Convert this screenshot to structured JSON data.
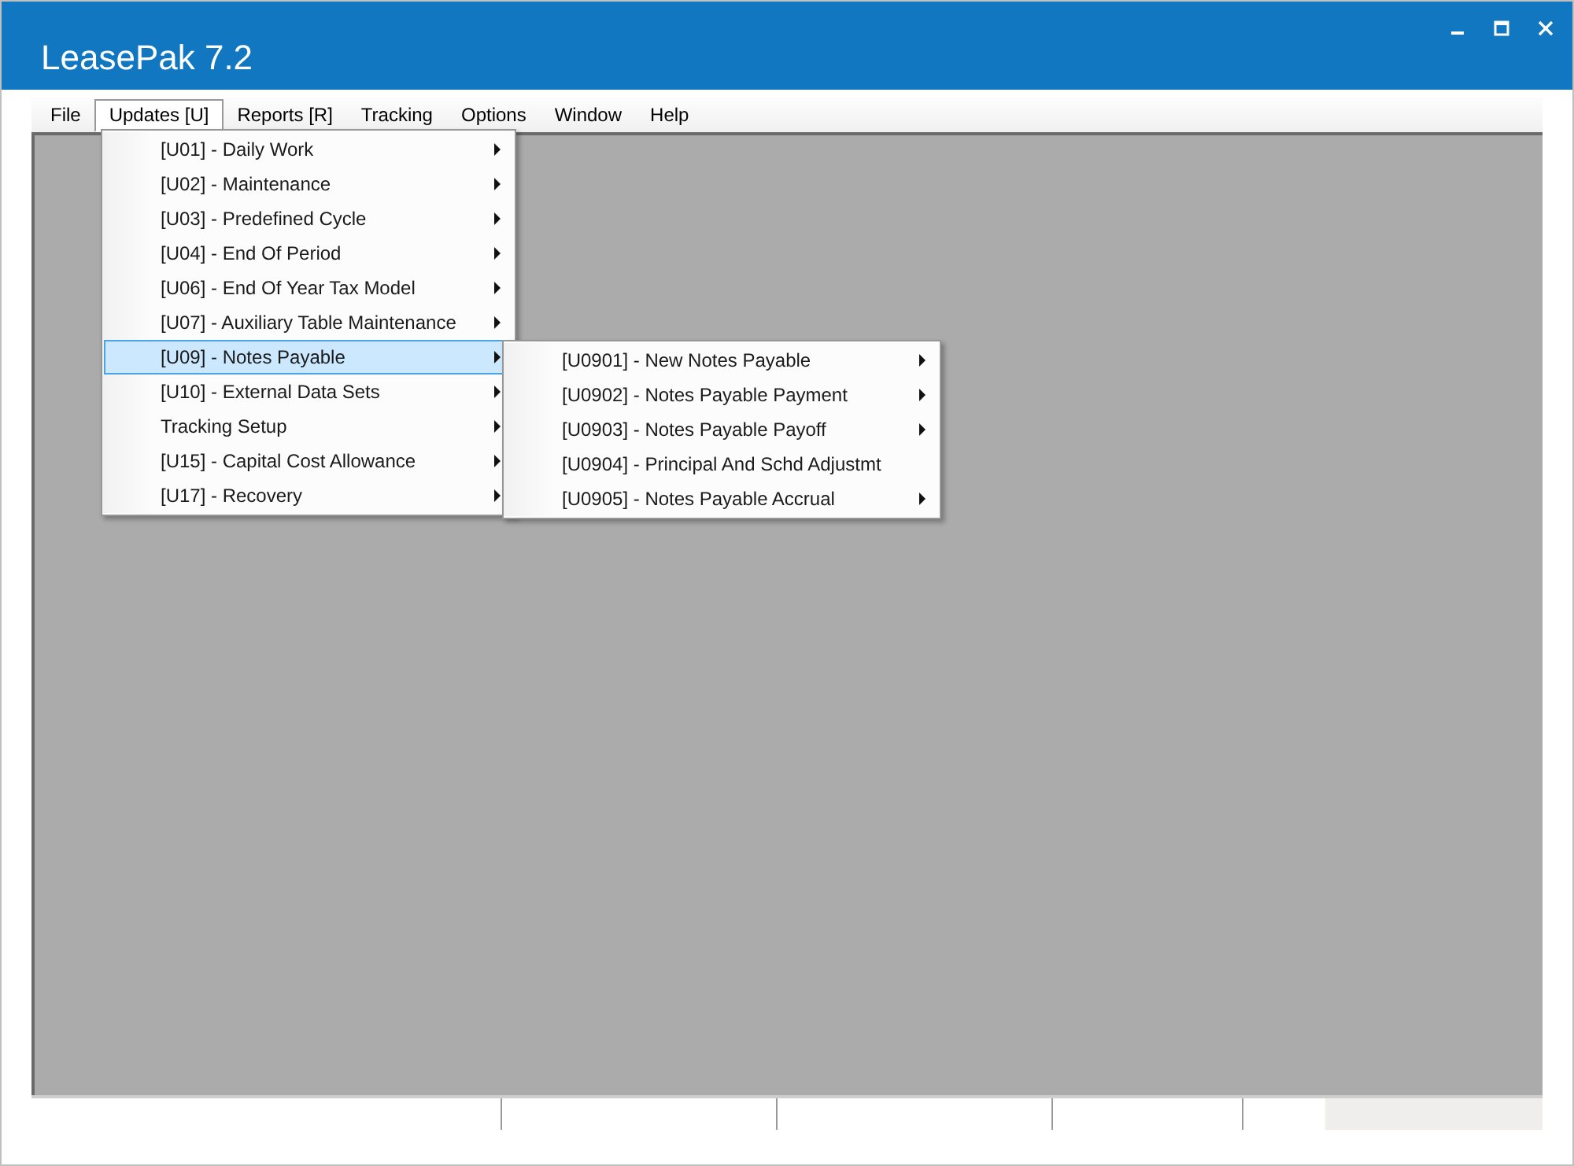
{
  "window": {
    "title": "LeasePak 7.2"
  },
  "menu_bar": [
    {
      "label": "File",
      "selected": false
    },
    {
      "label": "Updates [U]",
      "selected": true
    },
    {
      "label": "Reports [R]",
      "selected": false
    },
    {
      "label": "Tracking",
      "selected": false
    },
    {
      "label": "Options",
      "selected": false
    },
    {
      "label": "Window",
      "selected": false
    },
    {
      "label": "Help",
      "selected": false
    }
  ],
  "updates_menu": [
    {
      "label": "[U01] - Daily Work",
      "has_submenu": true,
      "selected": false
    },
    {
      "label": "[U02] - Maintenance",
      "has_submenu": true,
      "selected": false
    },
    {
      "label": "[U03] - Predefined Cycle",
      "has_submenu": true,
      "selected": false
    },
    {
      "label": "[U04] - End Of Period",
      "has_submenu": true,
      "selected": false
    },
    {
      "label": "[U06] - End Of Year Tax Model",
      "has_submenu": true,
      "selected": false
    },
    {
      "label": "[U07] - Auxiliary Table Maintenance",
      "has_submenu": true,
      "selected": false
    },
    {
      "label": "[U09] - Notes Payable",
      "has_submenu": true,
      "selected": true
    },
    {
      "label": "[U10] - External Data Sets",
      "has_submenu": true,
      "selected": false
    },
    {
      "label": "Tracking Setup",
      "has_submenu": true,
      "selected": false
    },
    {
      "label": "[U15] - Capital Cost Allowance",
      "has_submenu": true,
      "selected": false
    },
    {
      "label": "[U17] - Recovery",
      "has_submenu": true,
      "selected": false
    }
  ],
  "notes_payable_submenu": [
    {
      "label": "[U0901] - New Notes Payable",
      "has_submenu": true,
      "selected": false
    },
    {
      "label": "[U0902] - Notes Payable Payment",
      "has_submenu": true,
      "selected": false
    },
    {
      "label": "[U0903] - Notes Payable Payoff",
      "has_submenu": true,
      "selected": false
    },
    {
      "label": "[U0904] - Principal And Schd Adjustmt",
      "has_submenu": false,
      "selected": false
    },
    {
      "label": "[U0905] - Notes Payable Accrual",
      "has_submenu": true,
      "selected": false
    }
  ]
}
